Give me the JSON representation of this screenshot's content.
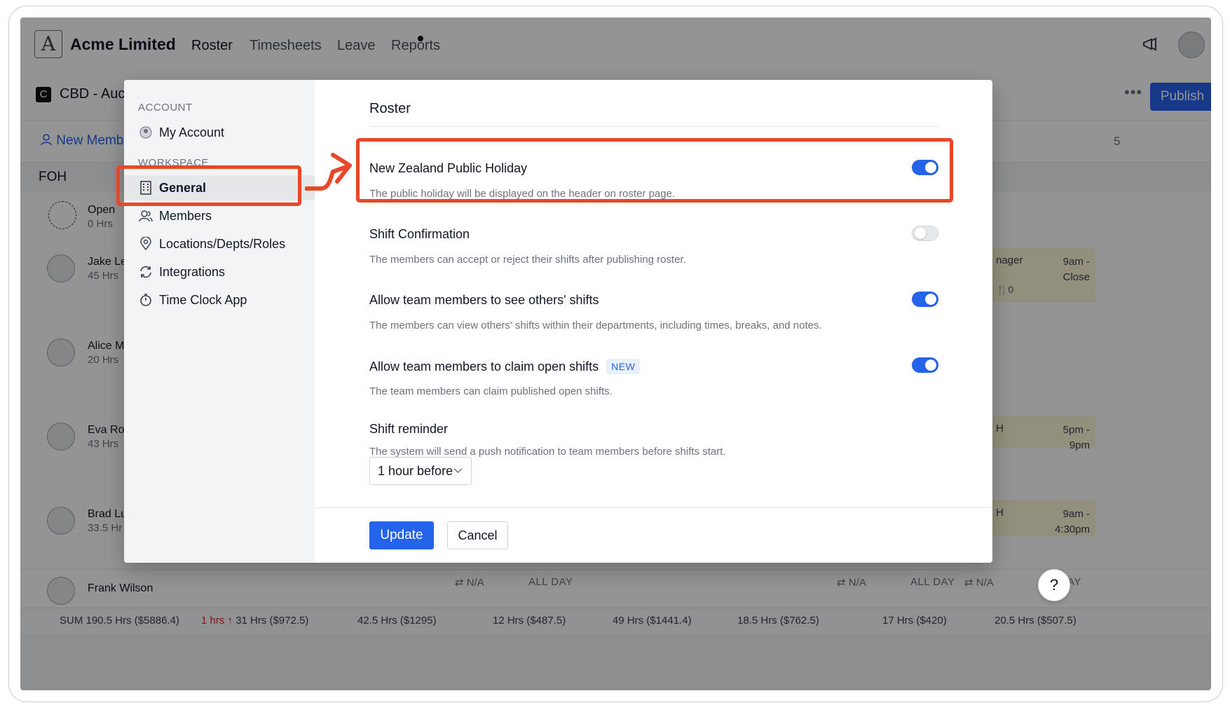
{
  "app": {
    "logo_glyph": "A",
    "company": "Acme Limited",
    "nav": [
      "Roster",
      "Timesheets",
      "Leave",
      "Reports"
    ],
    "active_nav": "Roster"
  },
  "toolbar": {
    "location_badge": "C",
    "location_name": "CBD - Auck",
    "more": "•••",
    "publish_label": "Publish"
  },
  "subrow": {
    "new_member_label": "New Memb",
    "col_fragment": "5"
  },
  "section": {
    "name": "FOH"
  },
  "members": [
    {
      "name": "Open",
      "hours": "0 Hrs"
    },
    {
      "name": "Jake Le",
      "hours": "45 Hrs"
    },
    {
      "name": "Alice M",
      "hours": "20 Hrs"
    },
    {
      "name": "Eva Roc",
      "hours": "43 Hrs"
    },
    {
      "name": "Brad Lu",
      "hours": "33.5 Hr"
    },
    {
      "name": "Frank Wilson",
      "hours": ""
    }
  ],
  "shifts": [
    {
      "role": "nager",
      "time_1": "9am -",
      "time_2": "Close",
      "extra": "🍴0"
    },
    {
      "role": "H",
      "time_1": "5pm -",
      "time_2": "9pm"
    },
    {
      "role": "H",
      "time_1": "9am -",
      "time_2": "4:30pm"
    }
  ],
  "frank_row": {
    "na": "N/A",
    "all_day": "ALL DAY",
    "ay_fragment": "AY"
  },
  "sums": {
    "total": "SUM 190.5 Hrs ($5886.4)",
    "delta": "1 hrs ↑",
    "col1": "31 Hrs ($972.5)",
    "col2": "42.5 Hrs ($1295)",
    "col3": "12 Hrs ($487.5)",
    "col4": "49 Hrs ($1441.4)",
    "col5": "18.5 Hrs ($762.5)",
    "col6": "17 Hrs ($420)",
    "col7": "20.5 Hrs ($507.5)"
  },
  "help_label": "?",
  "modal": {
    "account_heading": "ACCOUNT",
    "workspace_heading": "WORKSPACE",
    "account_items": [
      {
        "label": "My Account",
        "icon": "avatar-icon"
      }
    ],
    "workspace_items": [
      {
        "label": "General",
        "icon": "building-icon",
        "active": true
      },
      {
        "label": "Members",
        "icon": "users-icon"
      },
      {
        "label": "Locations/Depts/Roles",
        "icon": "location-pin-icon"
      },
      {
        "label": "Integrations",
        "icon": "sync-icon"
      },
      {
        "label": "Time Clock App",
        "icon": "stopwatch-icon"
      }
    ],
    "title": "Roster",
    "settings": [
      {
        "title": "New Zealand Public Holiday",
        "desc": "The public holiday will be displayed on the header on roster page.",
        "enabled": true
      },
      {
        "title": "Shift Confirmation",
        "desc": "The members can accept or reject their shifts after publishing roster.",
        "enabled": false
      },
      {
        "title": "Allow team members to see others' shifts",
        "desc": "The members can view others' shifts within their departments, including times, breaks, and notes.",
        "enabled": true
      },
      {
        "title": "Allow team members to claim open shifts",
        "badge": "NEW",
        "desc": "The team members can claim published open shifts.",
        "enabled": true
      }
    ],
    "reminder": {
      "title": "Shift reminder",
      "desc": "The system will send a push notification to team members before shifts start.",
      "selected": "1 hour before"
    },
    "update_label": "Update",
    "cancel_label": "Cancel"
  },
  "colors": {
    "accent": "#2563eb",
    "annotation": "#e8472a",
    "badge_bg": "#e8f0fe",
    "shift_bg": "#fdf6d8"
  }
}
